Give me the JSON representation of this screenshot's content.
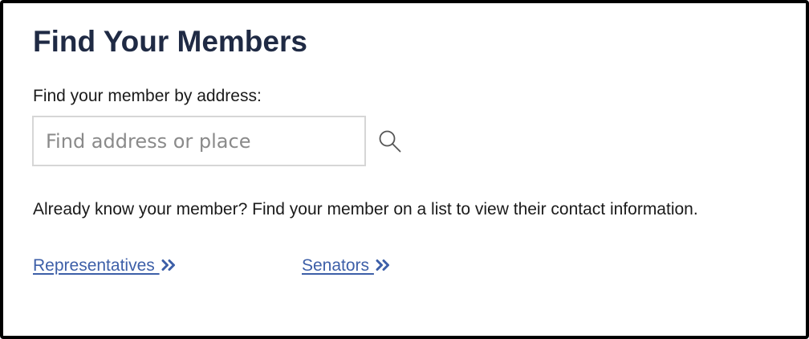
{
  "header": {
    "title": "Find Your Members"
  },
  "address_search": {
    "label": "Find your member by address:",
    "placeholder": "Find address or place",
    "value": "",
    "search_icon": "search-icon"
  },
  "members": {
    "info_text": "Already know your member? Find your member on a list to view their contact information.",
    "links": [
      {
        "label": "Representatives ",
        "icon": "double-chevron-right-icon"
      },
      {
        "label": "Senators ",
        "icon": "double-chevron-right-icon"
      }
    ]
  },
  "colors": {
    "title": "#1f2a44",
    "link": "#3d5fa8",
    "border": "#000000",
    "input_border": "#d6d6d6"
  }
}
